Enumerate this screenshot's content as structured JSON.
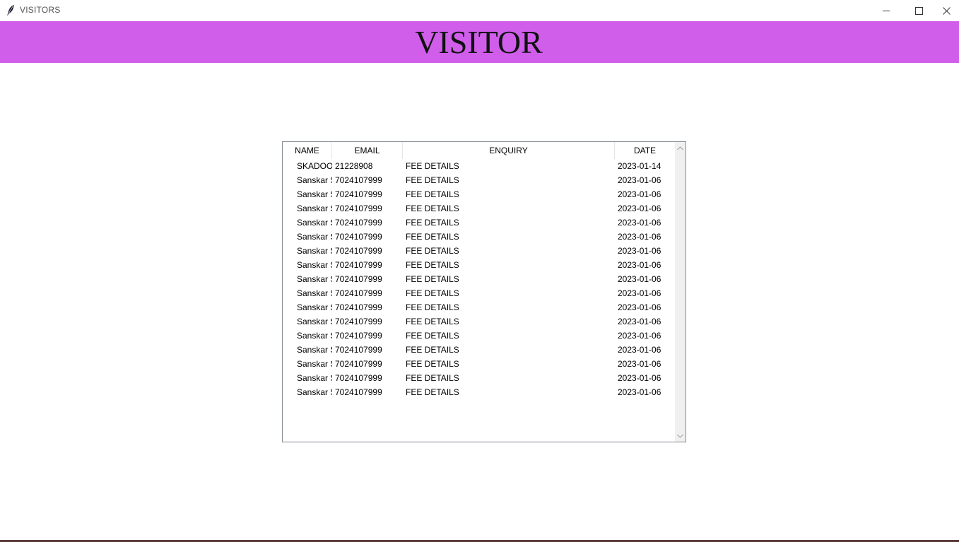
{
  "window": {
    "title": "VISITORS",
    "icon": "feather-icon",
    "controls": [
      "minimize-icon",
      "maximize-icon",
      "close-icon"
    ]
  },
  "banner": {
    "title": "VISITOR",
    "color": "#d05eeb"
  },
  "table": {
    "columns": [
      "NAME",
      "EMAIL",
      "ENQUIRY",
      "DATE"
    ],
    "rows": [
      [
        "SKADOOSH",
        "21228908",
        "FEE DETAILS",
        "2023-01-14"
      ],
      [
        "Sanskar Sharma",
        "7024107999",
        "FEE DETAILS",
        "2023-01-06"
      ],
      [
        "Sanskar Sharma",
        "7024107999",
        "FEE DETAILS",
        "2023-01-06"
      ],
      [
        "Sanskar Sharma",
        "7024107999",
        "FEE DETAILS",
        "2023-01-06"
      ],
      [
        "Sanskar Sharma",
        "7024107999",
        "FEE DETAILS",
        "2023-01-06"
      ],
      [
        "Sanskar Sharma",
        "7024107999",
        "FEE DETAILS",
        "2023-01-06"
      ],
      [
        "Sanskar Sharma",
        "7024107999",
        "FEE DETAILS",
        "2023-01-06"
      ],
      [
        "Sanskar Sharma",
        "7024107999",
        "FEE DETAILS",
        "2023-01-06"
      ],
      [
        "Sanskar Sharma",
        "7024107999",
        "FEE DETAILS",
        "2023-01-06"
      ],
      [
        "Sanskar Sharma",
        "7024107999",
        "FEE DETAILS",
        "2023-01-06"
      ],
      [
        "Sanskar Sharma",
        "7024107999",
        "FEE DETAILS",
        "2023-01-06"
      ],
      [
        "Sanskar Sharma",
        "7024107999",
        "FEE DETAILS",
        "2023-01-06"
      ],
      [
        "Sanskar Sharma",
        "7024107999",
        "FEE DETAILS",
        "2023-01-06"
      ],
      [
        "Sanskar Sharma",
        "7024107999",
        "FEE DETAILS",
        "2023-01-06"
      ],
      [
        "Sanskar Sharma",
        "7024107999",
        "FEE DETAILS",
        "2023-01-06"
      ],
      [
        "Sanskar Sharma",
        "7024107999",
        "FEE DETAILS",
        "2023-01-06"
      ],
      [
        "Sanskar Sharma",
        "7024107999",
        "FEE DETAILS",
        "2023-01-06"
      ]
    ]
  }
}
